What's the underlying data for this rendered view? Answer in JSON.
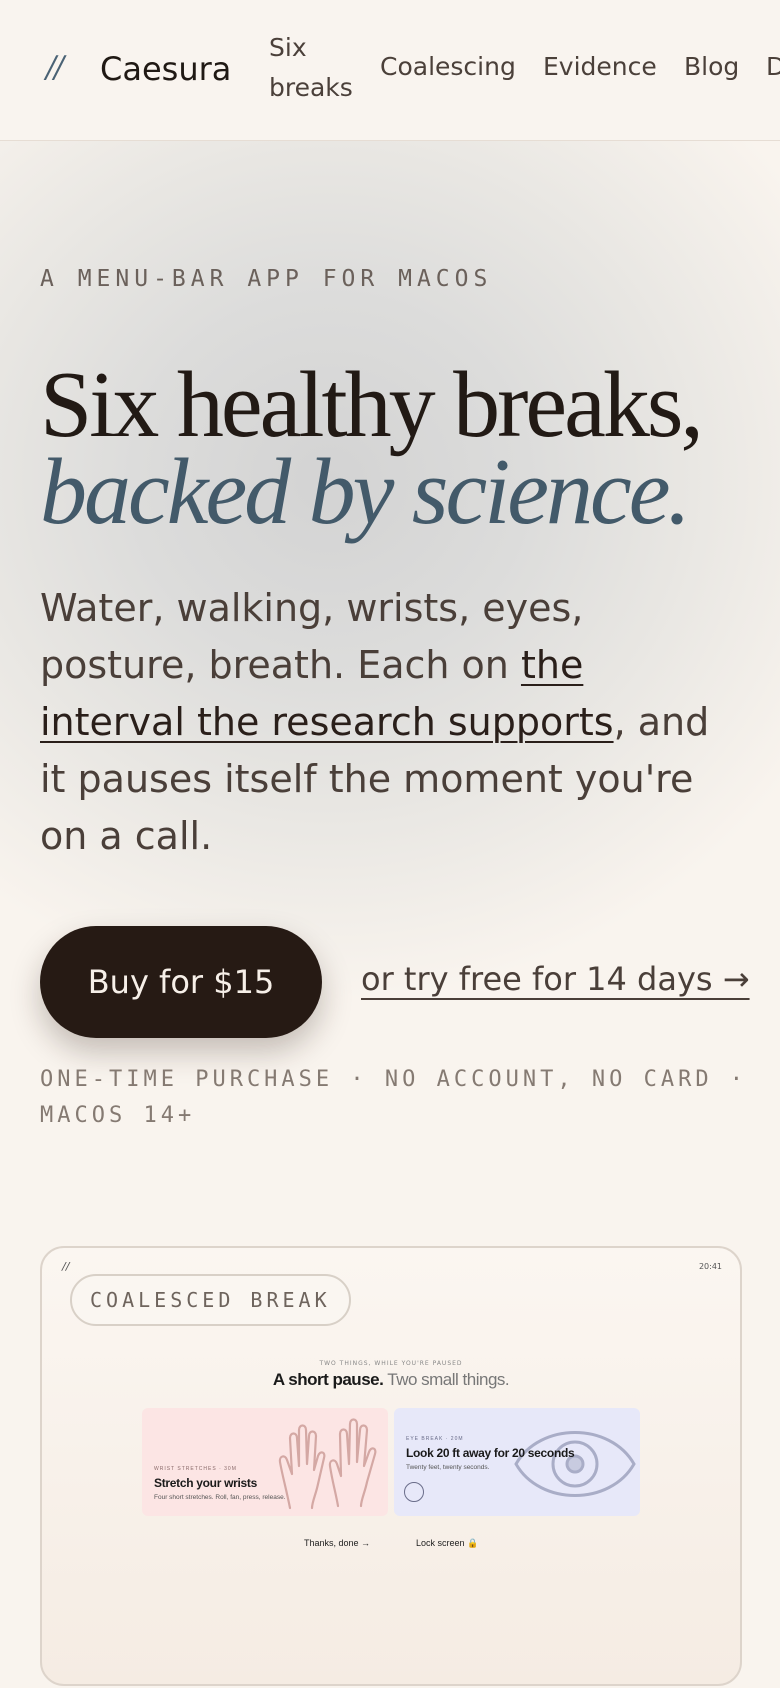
{
  "header": {
    "logo_mark": "//",
    "brand": "Caesura",
    "nav": [
      "Six breaks",
      "Coalescing",
      "Evidence",
      "Blog",
      "D"
    ]
  },
  "hero": {
    "eyebrow": "A MENU-BAR APP FOR MACOS",
    "headline_line1": "Six healthy breaks,",
    "headline_line2": "backed by science.",
    "lede_before": "Water, walking, wrists, eyes, posture, breath. Each on ",
    "lede_link": "the interval the research supports",
    "lede_after": ", and it pauses itself the moment you're on a call.",
    "buy_label": "Buy for $15",
    "trial_label": "or try free for 14 days →",
    "fine_print": "ONE-TIME PURCHASE · NO ACCOUNT, NO CARD · MACOS 14+"
  },
  "preview": {
    "logo_mark": "//",
    "clock": "20:41",
    "pill": "COALESCED BREAK",
    "eyebrow": "TWO THINGS, WHILE YOU'RE PAUSED",
    "title_bold": "A short pause.",
    "title_light": " Two small things.",
    "cards": [
      {
        "tag": "WRIST STRETCHES · 30M",
        "title": "Stretch your wrists",
        "sub": "Four short stretches. Roll, fan, press, release.",
        "icon": "hands-icon"
      },
      {
        "tag": "EYE BREAK · 20M",
        "title": "Look 20 ft away for 20 seconds",
        "sub": "Twenty feet, twenty seconds.",
        "icon": "eye-icon"
      }
    ],
    "action_done": "Thanks, done →",
    "action_lock": "Lock screen 🔒"
  },
  "colors": {
    "accent": "#435a6a",
    "button_bg": "#261a14",
    "page_bg": "#f9f4ee",
    "wrist_card": "#fce5e4",
    "eye_card": "#e7e8f9"
  }
}
